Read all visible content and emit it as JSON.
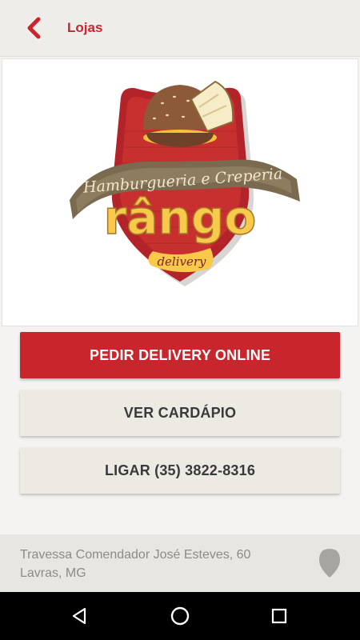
{
  "header": {
    "title": "Lojas",
    "back_icon": "arrow-left-icon",
    "accent_color": "#c8262c"
  },
  "logo": {
    "banner_text": "Hamburgueria e Creperia",
    "brand_text": "rângo",
    "tagline": "delivery"
  },
  "actions": {
    "order_label": "PEDIR DELIVERY ONLINE",
    "menu_label": "VER CARDÁPIO",
    "call_label": "LIGAR (35) 3822-8316"
  },
  "address": {
    "line1": "Travessa Comendador José Esteves, 60",
    "line2": "Lavras, MG",
    "icon": "map-pin-icon"
  },
  "system_nav": {
    "back_icon": "triangle-back-icon",
    "home_icon": "circle-home-icon",
    "recents_icon": "square-recents-icon"
  }
}
